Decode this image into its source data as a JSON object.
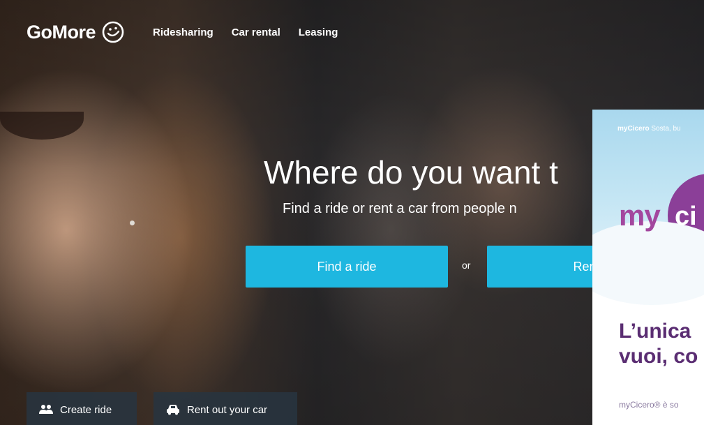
{
  "brand": {
    "name": "GoMore",
    "logo_icon": "smiley-icon"
  },
  "nav": {
    "items": [
      {
        "label": "Ridesharing"
      },
      {
        "label": "Car rental"
      },
      {
        "label": "Leasing"
      }
    ]
  },
  "hero": {
    "headline": "Where do you want t",
    "subline": "Find a ride or rent a car from people n",
    "find_ride_label": "Find a ride",
    "or_label": "or",
    "rent_label": "Rent a"
  },
  "bottom_actions": {
    "create_ride_label": "Create ride",
    "create_ride_icon": "users-icon",
    "rent_out_label": "Rent out your car",
    "rent_out_icon": "car-icon"
  },
  "ad": {
    "tagline_brand": "myCicero",
    "tagline_rest": " Sosta, bu",
    "logo_left": "my",
    "logo_right": "ci",
    "heading_line1": "L’unica",
    "heading_line2": "vuoi, co",
    "small_text": "myCicero® è so"
  },
  "colors": {
    "accent": "#1eb7e0",
    "ad_purple": "#8b3f98",
    "ad_heading": "#5a2d72"
  }
}
